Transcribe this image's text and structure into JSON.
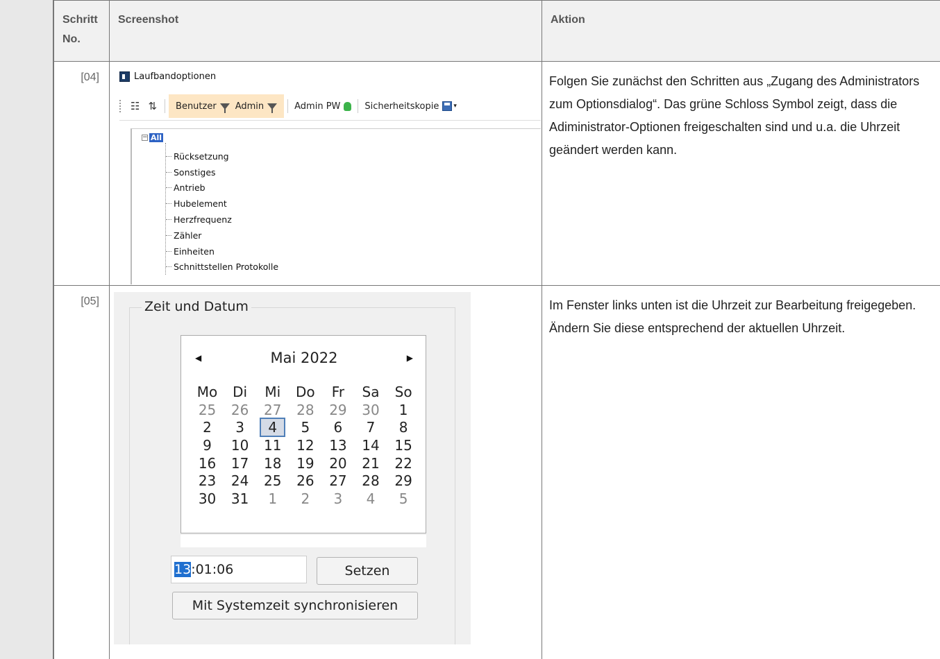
{
  "table": {
    "headers": {
      "step": "Schritt No.",
      "screenshot": "Screenshot",
      "action": "Aktion"
    }
  },
  "rows": [
    {
      "step": "[04]",
      "action": "Folgen Sie zunächst den Schritten aus „Zugang des Administrators zum Optionsdialog“. Das grüne Schloss Symbol zeigt, dass die Adiministrator-Optionen freigeschalten sind und u.a. die Uhrzeit geändert werden kann."
    },
    {
      "step": "[05]",
      "action": "Im Fenster links unten ist die Uhrzeit zur Bearbeitung freigegeben. Ändern Sie diese entsprechend der aktuellen Uhrzeit."
    }
  ],
  "shot04": {
    "window_title": "Laufbandoptionen",
    "toolbar": {
      "benutzer": "Benutzer",
      "admin": "Admin",
      "admin_pw": "Admin PW",
      "backup": "Sicherheitskopie"
    },
    "tree": {
      "root": "All",
      "items": [
        "Rücksetzung",
        "Sonstiges",
        "Antrieb",
        "Hubelement",
        "Herzfrequenz",
        "Zähler",
        "Einheiten",
        "Schnittstellen Protokolle"
      ]
    }
  },
  "shot05": {
    "group_title": "Zeit und Datum",
    "calendar": {
      "month": "Mai 2022",
      "weekdays": [
        "Mo",
        "Di",
        "Mi",
        "Do",
        "Fr",
        "Sa",
        "So"
      ],
      "weeks": [
        [
          "25",
          "26",
          "27",
          "28",
          "29",
          "30",
          "1"
        ],
        [
          "2",
          "3",
          "4",
          "5",
          "6",
          "7",
          "8"
        ],
        [
          "9",
          "10",
          "11",
          "12",
          "13",
          "14",
          "15"
        ],
        [
          "16",
          "17",
          "18",
          "19",
          "20",
          "21",
          "22"
        ],
        [
          "23",
          "24",
          "25",
          "26",
          "27",
          "28",
          "29"
        ],
        [
          "30",
          "31",
          "1",
          "2",
          "3",
          "4",
          "5"
        ]
      ],
      "selected_day": "4"
    },
    "time": {
      "hours": "13",
      "rest": ":01:06"
    },
    "set_button": "Setzen",
    "sync_button": "Mit Systemzeit synchronisieren"
  }
}
